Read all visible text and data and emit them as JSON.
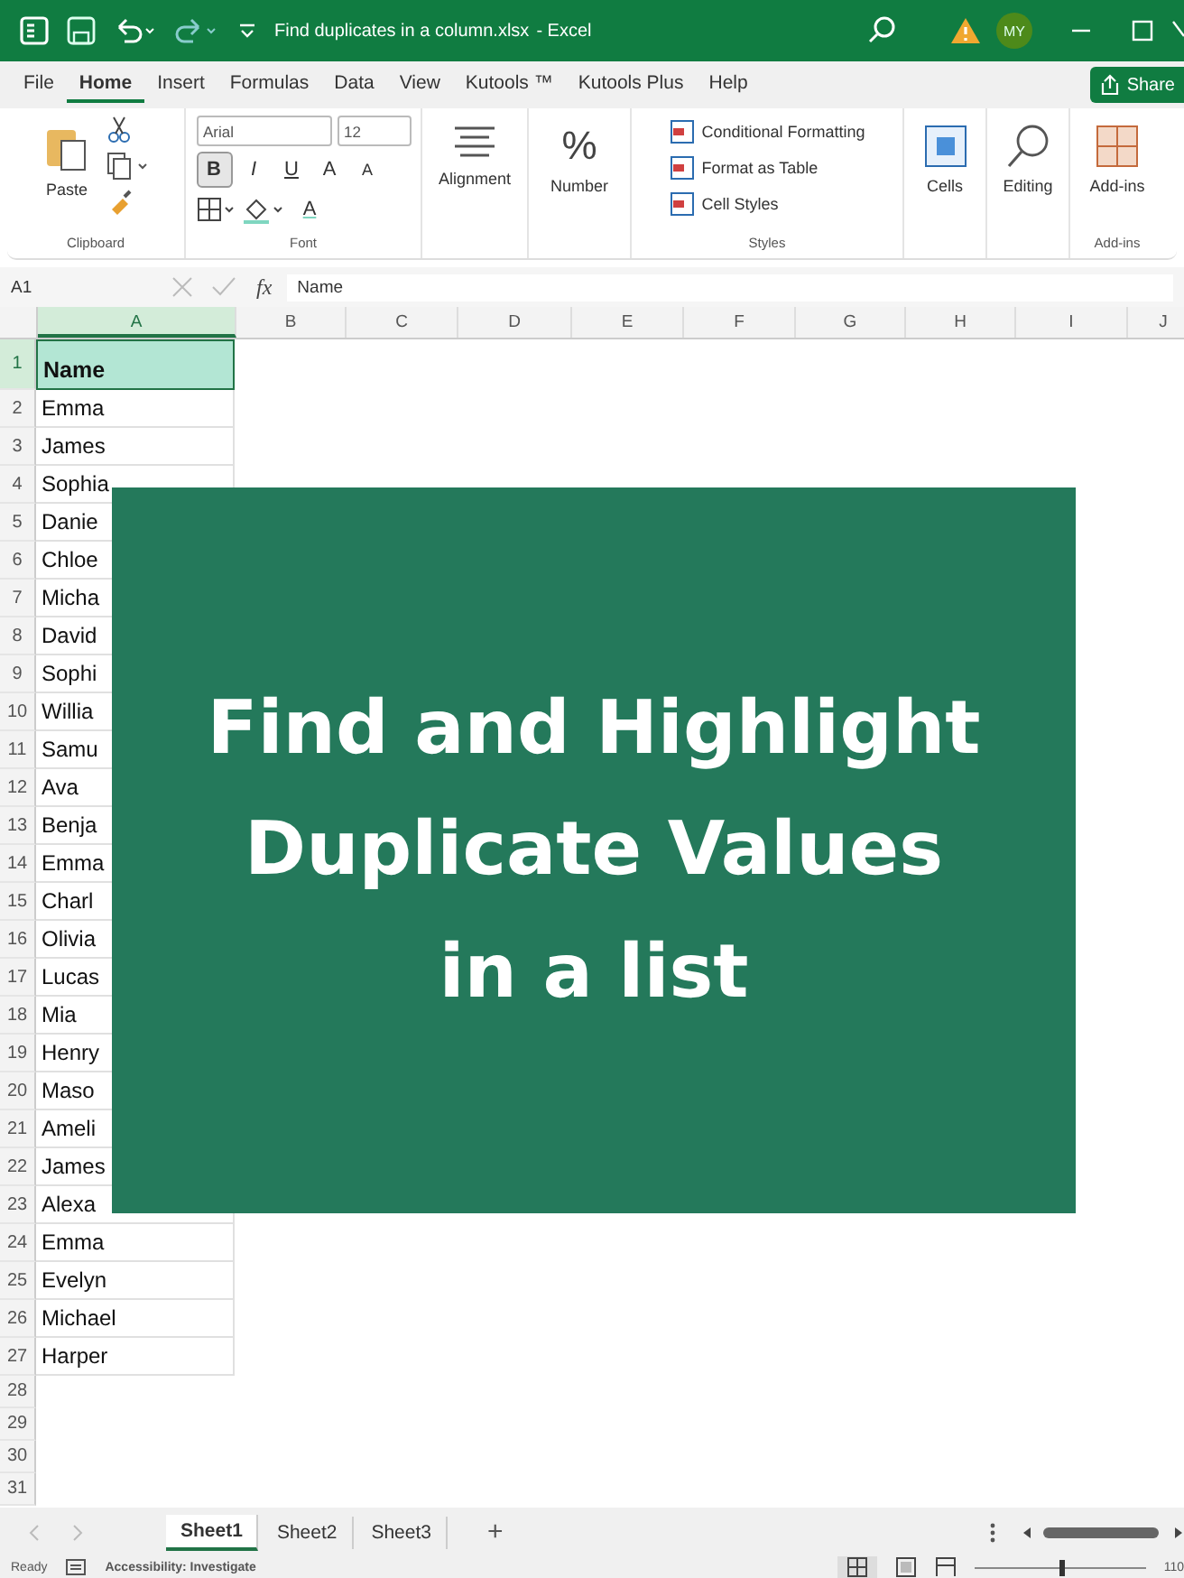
{
  "title_bar": {
    "title": "Find duplicates in a column.xlsx",
    "separator": "-",
    "app": "Excel",
    "avatar": "MY"
  },
  "tabs": [
    {
      "label": "File",
      "selected": false
    },
    {
      "label": "Home",
      "selected": true
    },
    {
      "label": "Insert",
      "selected": false
    },
    {
      "label": "Formulas",
      "selected": false
    },
    {
      "label": "Data",
      "selected": false
    },
    {
      "label": "View",
      "selected": false
    },
    {
      "label": "Kutools ™",
      "selected": false
    },
    {
      "label": "Kutools Plus",
      "selected": false
    },
    {
      "label": "Help",
      "selected": false
    }
  ],
  "share": "Share",
  "ribbon": {
    "paste": "Paste",
    "clipboard": "Clipboard",
    "font_name": "Arial",
    "font_size": "12",
    "bold": {
      "label": "B",
      "selected": true
    },
    "italic": {
      "label": "I",
      "selected": false
    },
    "underline": {
      "label": "U",
      "selected": false
    },
    "grow": "A",
    "shrink": "A",
    "font_color": "A",
    "font": "Font",
    "alignment": "Alignment",
    "number": "Number",
    "number_glyph": "%",
    "styles_items": [
      "Conditional Formatting",
      "Format as Table",
      "Cell Styles"
    ],
    "styles": "Styles",
    "cells": "Cells",
    "editing": "Editing",
    "addins": "Add-ins",
    "addins_group": "Add-ins"
  },
  "formula_bar": {
    "name_box": "A1",
    "fx": "fx",
    "value": "Name"
  },
  "columns": [
    "A",
    "B",
    "C",
    "D",
    "E",
    "F",
    "G",
    "H",
    "I",
    "J"
  ],
  "rows": [
    {
      "number": "1",
      "value": "Name",
      "selected": true
    },
    {
      "number": "2",
      "value": "Emma",
      "selected": false
    },
    {
      "number": "3",
      "value": "James",
      "selected": false
    },
    {
      "number": "4",
      "value": "Sophia",
      "selected": false
    },
    {
      "number": "5",
      "value": "Danie",
      "selected": false
    },
    {
      "number": "6",
      "value": "Chloe",
      "selected": false
    },
    {
      "number": "7",
      "value": "Micha",
      "selected": false
    },
    {
      "number": "8",
      "value": "David",
      "selected": false
    },
    {
      "number": "9",
      "value": "Sophi",
      "selected": false
    },
    {
      "number": "10",
      "value": "Willia",
      "selected": false
    },
    {
      "number": "11",
      "value": "Samu",
      "selected": false
    },
    {
      "number": "12",
      "value": "Ava",
      "selected": false
    },
    {
      "number": "13",
      "value": "Benja",
      "selected": false
    },
    {
      "number": "14",
      "value": "Emma",
      "selected": false
    },
    {
      "number": "15",
      "value": "Charl",
      "selected": false
    },
    {
      "number": "16",
      "value": "Olivia",
      "selected": false
    },
    {
      "number": "17",
      "value": "Lucas",
      "selected": false
    },
    {
      "number": "18",
      "value": "Mia",
      "selected": false
    },
    {
      "number": "19",
      "value": "Henry",
      "selected": false
    },
    {
      "number": "20",
      "value": "Maso",
      "selected": false
    },
    {
      "number": "21",
      "value": "Ameli",
      "selected": false
    },
    {
      "number": "22",
      "value": "James",
      "selected": false
    },
    {
      "number": "23",
      "value": "Alexa",
      "selected": false
    },
    {
      "number": "24",
      "value": "Emma",
      "selected": false
    },
    {
      "number": "25",
      "value": "Evelyn",
      "selected": false
    },
    {
      "number": "26",
      "value": "Michael",
      "selected": false
    },
    {
      "number": "27",
      "value": "Harper",
      "selected": false
    },
    {
      "number": "28",
      "selected": false
    },
    {
      "number": "29",
      "selected": false
    },
    {
      "number": "30",
      "selected": false
    },
    {
      "number": "31",
      "selected": false
    }
  ],
  "overlay": {
    "lines": [
      "Find and Highlight",
      "Duplicate Values",
      "in a list"
    ]
  },
  "sheets": [
    {
      "label": "Sheet1",
      "selected": true
    },
    {
      "label": "Sheet2",
      "selected": false
    },
    {
      "label": "Sheet3",
      "selected": false
    }
  ],
  "add_sheet": "+",
  "status_bar": {
    "ready": "Ready",
    "accessibility": "Accessibility: Investigate",
    "zoom": "110",
    "zoom_slider": {
      "level": 0.5
    }
  }
}
